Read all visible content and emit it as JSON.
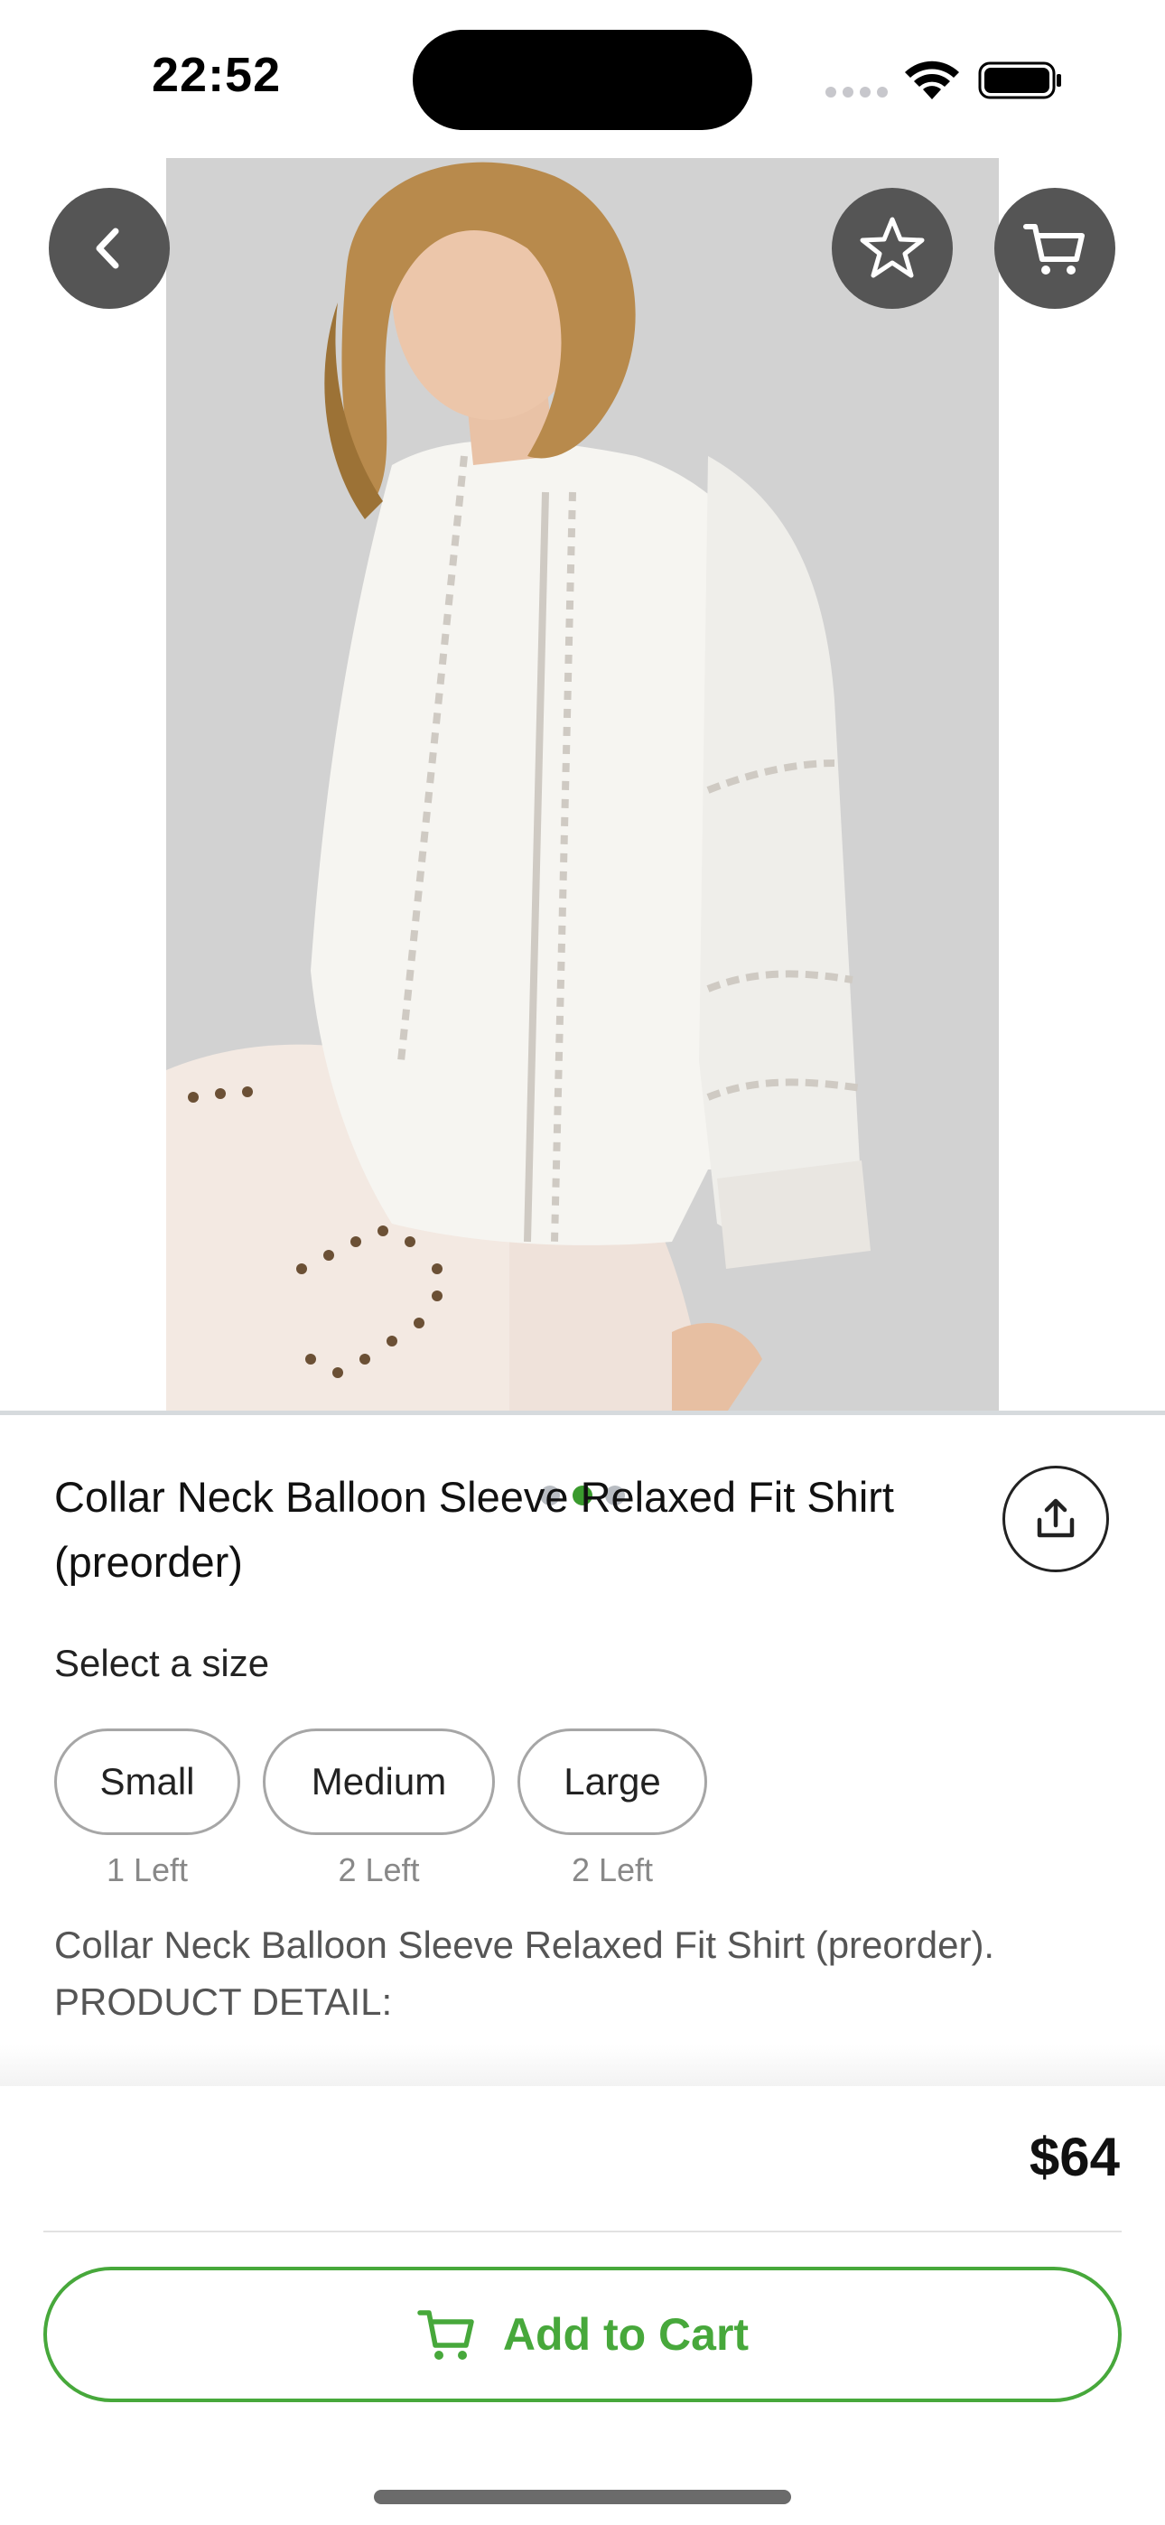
{
  "status_bar": {
    "time": "22:52",
    "icons": [
      "signal-icon",
      "wifi-icon",
      "battery-icon"
    ]
  },
  "header": {
    "icons": [
      "back-chevron-icon",
      "star-icon",
      "cart-icon"
    ]
  },
  "gallery": {
    "image_description": "Model wearing white lace-trim balloon sleeve shirt",
    "page_count": 3,
    "active_page": 2
  },
  "product": {
    "title": "Collar Neck Balloon Sleeve Relaxed Fit Shirt (preorder)",
    "share_icon": "share-icon",
    "size_label": "Select a size",
    "sizes": [
      {
        "label": "Small",
        "stock": "1 Left"
      },
      {
        "label": "Medium",
        "stock": "2 Left"
      },
      {
        "label": "Large",
        "stock": "2 Left"
      }
    ],
    "description_line1": "Collar Neck Balloon Sleeve Relaxed Fit Shirt (preorder).",
    "description_line2": "PRODUCT DETAIL:"
  },
  "purchase": {
    "price": "$64",
    "add_to_cart_label": "Add to Cart",
    "add_to_cart_icon": "cart-icon"
  },
  "colors": {
    "accent_green": "#47a83b",
    "overlay_button": "#555555",
    "pager_active": "#3a9a2e"
  }
}
